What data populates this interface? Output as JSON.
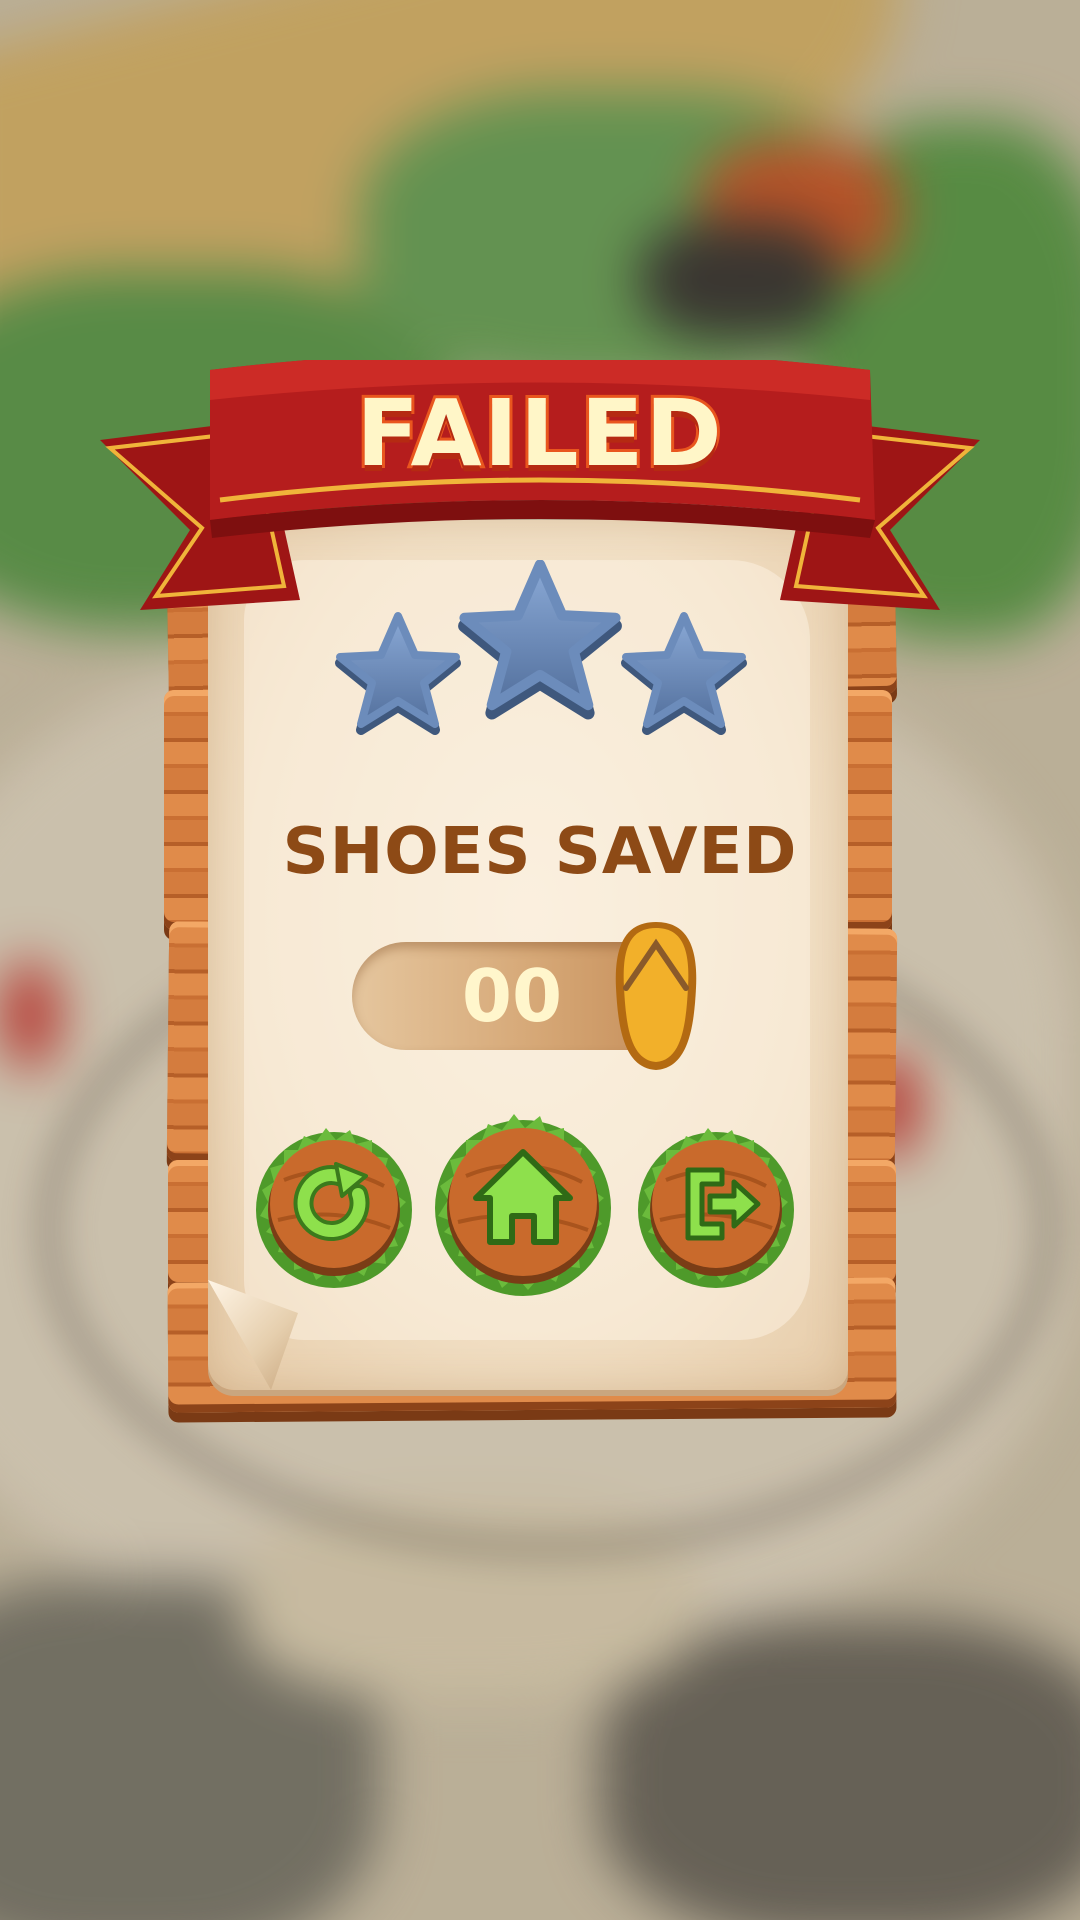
{
  "title": "FAILED",
  "stars": {
    "earned": 0,
    "total": 3
  },
  "shoes_saved": {
    "label": "SHOES SAVED",
    "value": "00"
  },
  "buttons": [
    {
      "name": "restart-button",
      "icon": "restart-icon"
    },
    {
      "name": "home-button",
      "icon": "home-icon"
    },
    {
      "name": "exit-button",
      "icon": "exit-icon"
    }
  ],
  "colors": {
    "ribbon": "#b51d1d",
    "title_fill": "#fff6c8",
    "title_stroke": "#e9561e",
    "star_empty": "#6e8fbd",
    "label": "#8d4a16",
    "wood": "#d47c3e",
    "button_icon": "#5cb83a",
    "grass": "#4e9a2a"
  }
}
